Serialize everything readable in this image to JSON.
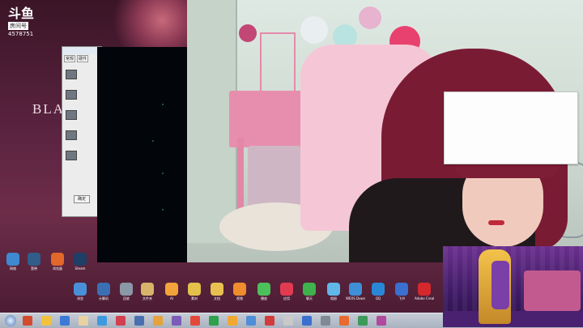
{
  "watermark": {
    "logo": "斗鱼",
    "room_label": "房间号",
    "room_id": "4578751"
  },
  "wallpaper": {
    "text": "BLA"
  },
  "dialog": {
    "tabs": [
      "常规",
      "硬件"
    ],
    "button_label": "确定"
  },
  "desktop_icons_top": [
    {
      "label": "网络",
      "color": "#3e89d0"
    },
    {
      "label": "宽带",
      "color": "#315d8a"
    },
    {
      "label": "浏览器",
      "color": "#e2672b"
    },
    {
      "label": "Steam",
      "color": "#1f3f66"
    }
  ],
  "desktop_icons_bottom": [
    {
      "label": "浏览",
      "color": "#4a90d9"
    },
    {
      "label": "计算机",
      "color": "#3a6fb3"
    },
    {
      "label": "回收",
      "color": "#8a98a8"
    },
    {
      "label": "文件夹",
      "color": "#d8b46a"
    },
    {
      "label": "AI",
      "color": "#f2a33a"
    },
    {
      "label": "素材",
      "color": "#e3c14b"
    },
    {
      "label": "文档",
      "color": "#e8c050"
    },
    {
      "label": "视频",
      "color": "#ef8c2d"
    },
    {
      "label": "播放",
      "color": "#4cc05a"
    },
    {
      "label": "应用",
      "color": "#e23b51"
    },
    {
      "label": "聊天",
      "color": "#3fb24d"
    },
    {
      "label": "相册",
      "color": "#5fb8e8"
    },
    {
      "label": "WEXS Download",
      "color": "#3e8fd8"
    },
    {
      "label": "QQ",
      "color": "#2a86d6"
    },
    {
      "label": "飞书",
      "color": "#3b6fd0"
    },
    {
      "label": "Adobe Creat",
      "color": "#d4282d"
    }
  ],
  "taskbar_items": [
    "#d24b2f",
    "#f3c13c",
    "#3c7ad6",
    "#e7d2a3",
    "#3e9ae0",
    "#d33f4f",
    "#4a6fb0",
    "#e6a23c",
    "#7b5db8",
    "#e3483b",
    "#2ea14b",
    "#f0a830",
    "#4f8ed8",
    "#d23b3b",
    "#c9c9c9",
    "#3b6fd0",
    "#7f8a96",
    "#e96a2f",
    "#3d9a5a",
    "#b04a9c"
  ]
}
